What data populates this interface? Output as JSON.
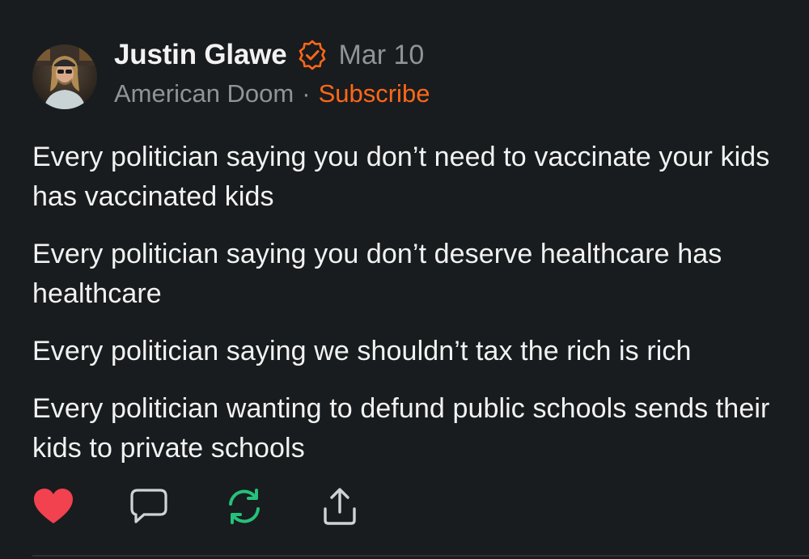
{
  "post": {
    "author_name": "Justin Glawe",
    "date": "Mar 10",
    "publication": "American Doom",
    "separator": "·",
    "subscribe_label": "Subscribe",
    "paragraphs": [
      "Every politician saying you don’t need to vaccinate your kids has vaccinated kids",
      "Every politician saying you don’t deserve healthcare has healthcare",
      "Every politician saying we shouldn’t tax the rich is rich",
      "Every politician wanting to defund public schools sends their kids to private schools"
    ],
    "actions": [
      {
        "icon": "heart-icon",
        "state": "liked"
      },
      {
        "icon": "comment-icon"
      },
      {
        "icon": "restack-icon"
      },
      {
        "icon": "share-icon"
      }
    ]
  },
  "colors": {
    "background": "#181c1e",
    "text": "#f2f2f2",
    "muted": "#8f9497",
    "accent": "#ff6719",
    "like": "#f2414f",
    "restack": "#26c07a"
  }
}
